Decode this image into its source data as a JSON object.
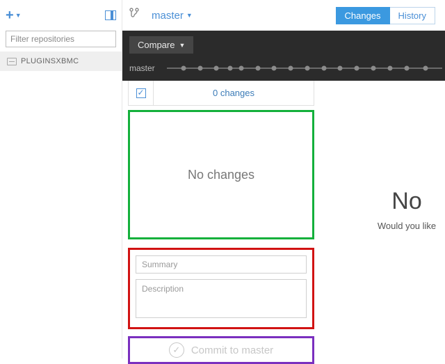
{
  "sidebar": {
    "filter_placeholder": "Filter repositories",
    "repos": [
      {
        "name": "PLUGINSXBMC"
      }
    ]
  },
  "toolbar": {
    "branch": "master",
    "tabs": {
      "changes": "Changes",
      "history": "History",
      "active": "changes"
    }
  },
  "graph": {
    "compare_label": "Compare",
    "track_label": "master",
    "dot_positions_pct": [
      6,
      12,
      18,
      23,
      27,
      33,
      39,
      45,
      51,
      57,
      63,
      69,
      75,
      81,
      87,
      94
    ]
  },
  "changes": {
    "count_label": "0 changes",
    "empty_label": "No changes"
  },
  "commit": {
    "summary_placeholder": "Summary",
    "description_placeholder": "Description",
    "button_label": "Commit to master"
  },
  "empty_state": {
    "headline": "No",
    "subline": "Would you like"
  }
}
